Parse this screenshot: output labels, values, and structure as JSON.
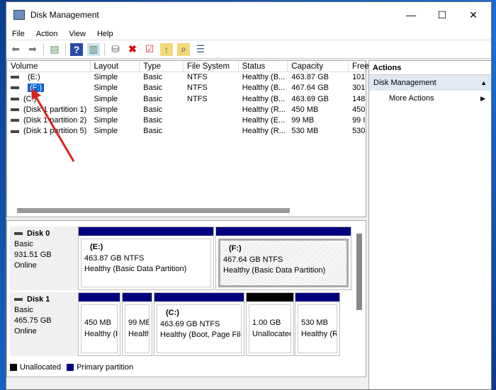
{
  "window": {
    "title": "Disk Management",
    "min": "—",
    "max": "☐",
    "close": "✕"
  },
  "menu": [
    "File",
    "Action",
    "View",
    "Help"
  ],
  "columns": [
    "Volume",
    "Layout",
    "Type",
    "File System",
    "Status",
    "Capacity",
    "Free"
  ],
  "rows": [
    [
      "(E:)",
      "Simple",
      "Basic",
      "NTFS",
      "Healthy (B...",
      "463.87 GB",
      "101"
    ],
    [
      "(F:)",
      "Simple",
      "Basic",
      "NTFS",
      "Healthy (B...",
      "467.64 GB",
      "301"
    ],
    [
      "(C:)",
      "Simple",
      "Basic",
      "NTFS",
      "Healthy (B...",
      "463.69 GB",
      "148"
    ],
    [
      "(Disk 1 partition 1)",
      "Simple",
      "Basic",
      "",
      "Healthy (R...",
      "450 MB",
      "450"
    ],
    [
      "(Disk 1 partition 2)",
      "Simple",
      "Basic",
      "",
      "Healthy (E...",
      "99 MB",
      "99 I"
    ],
    [
      "(Disk 1 partition 5)",
      "Simple",
      "Basic",
      "",
      "Healthy (R...",
      "530 MB",
      "530"
    ]
  ],
  "actions": {
    "header": "Actions",
    "section": "Disk Management",
    "more": "More Actions"
  },
  "disks": [
    {
      "name": "Disk 0",
      "type": "Basic",
      "size": "931.51 GB",
      "status": "Online",
      "parts": [
        {
          "label": "(E:)",
          "l1": "463.87 GB NTFS",
          "l2": "Healthy (Basic Data Partition)"
        },
        {
          "label": "(F:)",
          "l1": "467.64 GB NTFS",
          "l2": "Healthy (Basic Data Partition)"
        }
      ]
    },
    {
      "name": "Disk 1",
      "type": "Basic",
      "size": "465.75 GB",
      "status": "Online",
      "parts": [
        {
          "label": "",
          "l1": "450 MB",
          "l2": "Healthy (R"
        },
        {
          "label": "",
          "l1": "99 MB",
          "l2": "Health"
        },
        {
          "label": "(C:)",
          "l1": "463.69 GB NTFS",
          "l2": "Healthy (Boot, Page File"
        },
        {
          "label": "",
          "l1": "1.00 GB",
          "l2": "Unallocated"
        },
        {
          "label": "",
          "l1": "530 MB",
          "l2": "Healthy (R"
        }
      ]
    }
  ],
  "legend": {
    "unallocated": "Unallocated",
    "primary": "Primary partition"
  },
  "colors": {
    "primary": "#00007f",
    "unallocated": "#000000",
    "selection": "#0a64d2"
  }
}
